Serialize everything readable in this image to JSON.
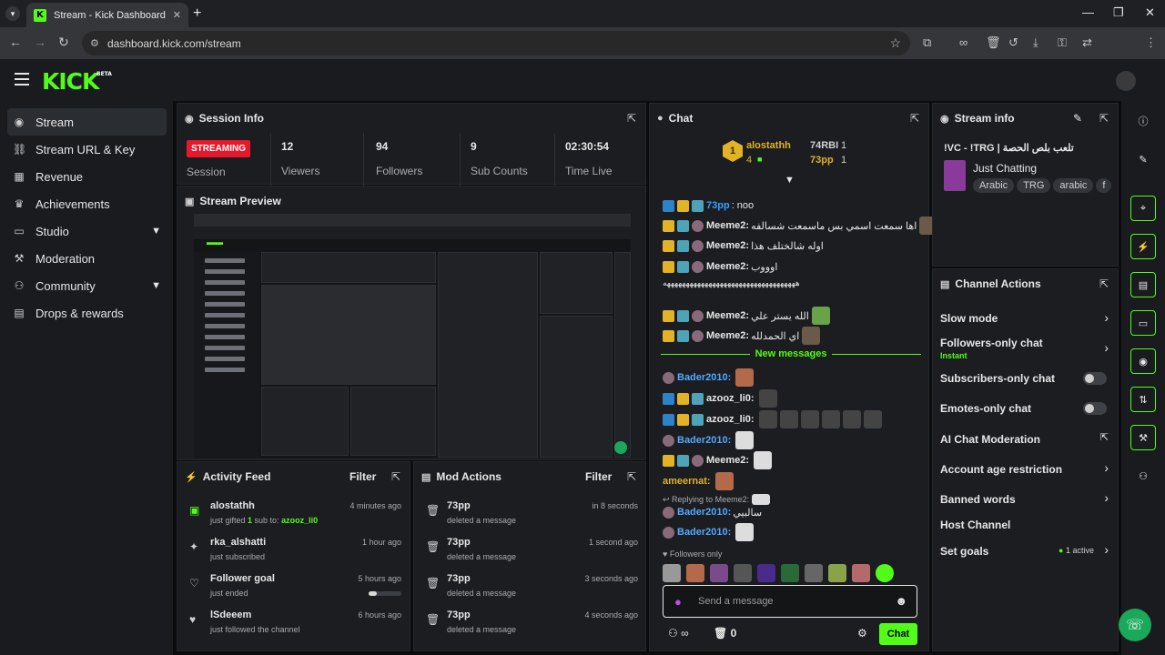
{
  "browser": {
    "tab_title": "Stream - Kick Dashboard",
    "url": "dashboard.kick.com/stream"
  },
  "brand": {
    "logo": "KICK",
    "beta": "BETA",
    "accent": "#53fc18"
  },
  "sidebar": {
    "items": [
      {
        "label": "Stream",
        "icon": "broadcast-icon"
      },
      {
        "label": "Stream URL & Key",
        "icon": "link-icon"
      },
      {
        "label": "Revenue",
        "icon": "chart-icon"
      },
      {
        "label": "Achievements",
        "icon": "trophy-icon"
      },
      {
        "label": "Studio",
        "icon": "monitor-icon"
      },
      {
        "label": "Moderation",
        "icon": "wrench-icon"
      },
      {
        "label": "Community",
        "icon": "people-icon"
      },
      {
        "label": "Drops & rewards",
        "icon": "gift-icon"
      }
    ]
  },
  "session": {
    "title": "Session Info",
    "status": "STREAMING",
    "status_label": "Session",
    "viewers": "12",
    "viewers_label": "Viewers",
    "followers": "94",
    "followers_label": "Followers",
    "subs": "9",
    "subs_label": "Sub Counts",
    "time": "02:30:54",
    "time_label": "Time Live"
  },
  "preview": {
    "title": "Stream Preview"
  },
  "activity": {
    "title": "Activity Feed",
    "filter": "Filter",
    "items": [
      {
        "name": "alostathh",
        "sub_pre": "just gifted ",
        "sub_count": "1",
        "sub_mid": " sub to: ",
        "sub_user": "azooz_li0",
        "time": "4 minutes ago"
      },
      {
        "name": "rka_alshatti",
        "sub": "just subscribed",
        "time": "1 hour ago"
      },
      {
        "name": "Follower goal",
        "sub": "just ended",
        "time": "5 hours ago",
        "progress": 0.25
      },
      {
        "name": "lSdeeem",
        "sub": "just followed the channel",
        "time": "6 hours ago"
      }
    ]
  },
  "mod": {
    "title": "Mod Actions",
    "filter": "Filter",
    "items": [
      {
        "name": "73pp",
        "sub": "deleted a message",
        "time": "in 8 seconds"
      },
      {
        "name": "73pp",
        "sub": "deleted a message",
        "time": "1 second ago"
      },
      {
        "name": "73pp",
        "sub": "deleted a message",
        "time": "3 seconds ago"
      },
      {
        "name": "73pp",
        "sub": "deleted a message",
        "time": "4 seconds ago"
      }
    ]
  },
  "chat": {
    "title": "Chat",
    "leader": {
      "rank": "1",
      "name": "alostathh",
      "count": "4"
    },
    "gifters": [
      {
        "name": "74RBI",
        "count": "1"
      },
      {
        "name": "73pp",
        "count": "1"
      }
    ],
    "messages": [
      {
        "user": "73pp",
        "text": ": noo",
        "color": "#3aa0ff"
      },
      {
        "user": "Meeme2:",
        "text": "اها سمعت اسمي بس ماسمعت شسالفه",
        "color": "#d8d8d8"
      },
      {
        "user": "Meeme2:",
        "text": "اوله شالختلف هذا",
        "color": "#d8d8d8"
      },
      {
        "user": "Meeme2:",
        "text": "اوووب",
        "color": "#d8d8d8"
      },
      {
        "user": "",
        "text": "هههههههههههههههههههههههههههههههههههه",
        "color": "#d8d8d8"
      },
      {
        "user": "Meeme2:",
        "text": "الله يستر علي",
        "color": "#d8d8d8"
      },
      {
        "user": "Meeme2:",
        "text": "اي الحمدلله",
        "color": "#d8d8d8"
      }
    ],
    "new_messages": "New messages",
    "new": [
      {
        "user": "Bader2010:",
        "color": "#53a8ff"
      },
      {
        "user": "azooz_li0:",
        "color": "#d8d8d8"
      },
      {
        "user": "azooz_li0:",
        "color": "#d8d8d8"
      },
      {
        "user": "Bader2010:",
        "color": "#53a8ff"
      },
      {
        "user": "Meeme2:",
        "color": "#d8d8d8"
      },
      {
        "user": "ameernat:",
        "color": "#e2b227"
      }
    ],
    "reply_label": "Replying to Meeme2:",
    "reply_user": "Bader2010:",
    "reply_text": "سالبيي",
    "last_user": "Bader2010:",
    "followers_only": "Followers only",
    "placeholder": "Send a message",
    "timeout_count": "0",
    "send": "Chat"
  },
  "stream_info": {
    "title": "Stream info",
    "stream_title": "!VC - !TRG | تلعب بلص الحصة",
    "category": "Just Chatting",
    "tags": [
      "Arabic",
      "TRG",
      "arabic",
      "f"
    ]
  },
  "channel_actions": {
    "title": "Channel Actions",
    "slow_mode": "Slow mode",
    "followers_only": "Followers-only chat",
    "followers_only_sub": "Instant",
    "subscribers_only": "Subscribers-only chat",
    "emotes_only": "Emotes-only chat",
    "ai_mod": "AI Chat Moderation",
    "account_age": "Account age restriction",
    "banned_words": "Banned words",
    "host": "Host Channel",
    "set_goals": "Set goals",
    "goals_active": "1 active"
  }
}
